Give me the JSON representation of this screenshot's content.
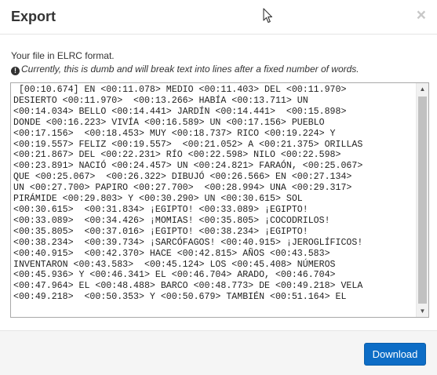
{
  "dialog": {
    "title": "Export",
    "close_label": "×"
  },
  "body": {
    "intro": "Your file in ELRC format.",
    "note": "Currently, this is dumb and will break text into lines after a fixed number of words.",
    "note_icon": "!",
    "export_text": " [00:10.674] EN <00:11.078> MEDIO <00:11.403> DEL <00:11.970>\nDESIERTO <00:11.970>  <00:13.266> HABÍA <00:13.711> UN\n<00:14.034> BELLO <00:14.441> JARDÍN <00:14.441>  <00:15.898>\nDONDE <00:16.223> VIVÍA <00:16.589> UN <00:17.156> PUEBLO\n<00:17.156>  <00:18.453> MUY <00:18.737> RICO <00:19.224> Y\n<00:19.557> FELIZ <00:19.557>  <00:21.052> A <00:21.375> ORILLAS\n<00:21.867> DEL <00:22.231> RÍO <00:22.598> NILO <00:22.598>\n<00:23.891> NACIÓ <00:24.457> UN <00:24.821> FARAÓN, <00:25.067>\nQUE <00:25.067>  <00:26.322> DIBUJÓ <00:26.566> EN <00:27.134>\nUN <00:27.700> PAPIRO <00:27.700>  <00:28.994> UNA <00:29.317>\nPIRÁMIDE <00:29.803> Y <00:30.290> UN <00:30.615> SOL\n<00:30.615>  <00:31.834> ¡EGIPTO! <00:33.089> ¡EGIPTO!\n<00:33.089>  <00:34.426> ¡MOMIAS! <00:35.805> ¡COCODRILOS!\n<00:35.805>  <00:37.016> ¡EGIPTO! <00:38.234> ¡EGIPTO!\n<00:38.234>  <00:39.734> ¡SARCÓFAGOS! <00:40.915> ¡JEROGLÍFICOS!\n<00:40.915>  <00:42.370> HACE <00:42.815> AÑOS <00:43.583>\nINVENTARON <00:43.583>  <00:45.124> LOS <00:45.408> NÚMEROS\n<00:45.936> Y <00:46.341> EL <00:46.704> ARADO, <00:46.704>\n<00:47.964> EL <00:48.488> BARCO <00:48.773> DE <00:49.218> VELA\n<00:49.218>  <00:50.353> Y <00:50.679> TAMBIÉN <00:51.164> EL"
  },
  "footer": {
    "download_label": "Download"
  },
  "icons": {
    "close": "close-icon",
    "note": "exclamation-circle-icon",
    "cursor": "mouse-pointer-icon"
  },
  "colors": {
    "primary_button": "#0d6dc6",
    "footer_bg": "#f5f5f5",
    "border": "#e5e5e5"
  }
}
